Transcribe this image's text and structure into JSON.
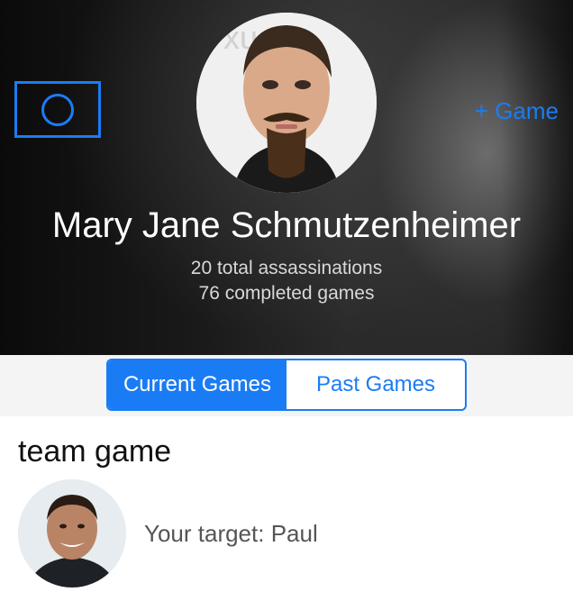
{
  "header": {
    "add_game_label": "+ Game",
    "settings_icon": "circle-icon",
    "profile": {
      "name": "Mary Jane Schmutzenheimer",
      "total_assassinations": "20 total assassinations",
      "completed_games": "76 completed games",
      "avatar_icon": "profile-photo"
    }
  },
  "tabs": {
    "items": [
      {
        "label": "Current Games",
        "selected": true
      },
      {
        "label": "Past Games",
        "selected": false
      }
    ]
  },
  "games": [
    {
      "title": "team game",
      "target_text": "Your target: Paul",
      "avatar_icon": "target-photo"
    }
  ],
  "colors": {
    "accent": "#1a7cf5",
    "header_bg": "#1b1b1b"
  }
}
